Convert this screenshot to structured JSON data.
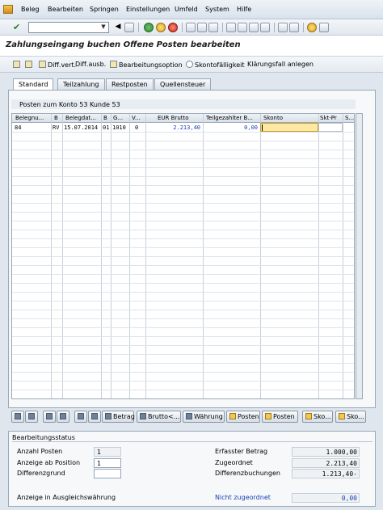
{
  "menu": {
    "items": [
      "Beleg",
      "Bearbeiten",
      "Springen",
      "Einstellungen",
      "Umfeld",
      "System",
      "Hilfe"
    ]
  },
  "toolbar": {
    "command_field_value": ""
  },
  "title": "Zahlungseingang buchen Offene Posten bearbeiten",
  "app_toolbar": {
    "diff_vert": "Diff.vert.",
    "diff_ausb": "Diff.ausb.",
    "bearbeitungsoption": "Bearbeitungsoption",
    "skontofaelligkeit": "Skontofälligkeit",
    "klaerungsfall": "Klärungsfall anlegen"
  },
  "tabs": [
    "Standard",
    "Teilzahlung",
    "Restposten",
    "Quellensteuer"
  ],
  "grid": {
    "title": "Posten zum Konto 53 Kunde 53",
    "columns": [
      "Belegnu...",
      "B",
      "Belegdat...",
      "B",
      "G...",
      "V...",
      "EUR Brutto",
      "Teilgezahlter B...",
      "Skonto",
      "Skt-Pr",
      "S..."
    ],
    "rows": [
      {
        "belegnr": "84",
        "ba": "RV",
        "belegdatum": "15.07.2014",
        "b2": "01",
        "g": "1010",
        "v": "0",
        "brutto": "2.213,40",
        "teilgezahlt": "0,00",
        "skonto": "",
        "sktpr": ""
      }
    ]
  },
  "buttons": {
    "betrag": "Betrag",
    "brutto": "Brutto<...",
    "waehrung": "Währung",
    "posten1": "Posten",
    "posten2": "Posten",
    "sko1": "Sko...",
    "sko2": "Sko..."
  },
  "status": {
    "title": "Bearbeitungsstatus",
    "anzahl_posten_label": "Anzahl Posten",
    "anzahl_posten_value": "1",
    "anzeige_ab_label": "Anzeige ab Position",
    "anzeige_ab_value": "1",
    "differenzgrund_label": "Differenzgrund",
    "differenzgrund_value": "",
    "ausgleich_label": "Anzeige in Ausgleichswährung",
    "erfasster_betrag_label": "Erfasster Betrag",
    "erfasster_betrag_value": "1.000,00",
    "zugeordnet_label": "Zugeordnet",
    "zugeordnet_value": "2.213,40",
    "differenzbuchungen_label": "Differenzbuchungen",
    "differenzbuchungen_value": "1.213,40-",
    "nicht_zugeordnet_label": "Nicht zugeordnet",
    "nicht_zugeordnet_value": "0,00"
  },
  "colors": {
    "accent_blue": "#1a3fb5",
    "input_highlight": "#fde9a4"
  }
}
